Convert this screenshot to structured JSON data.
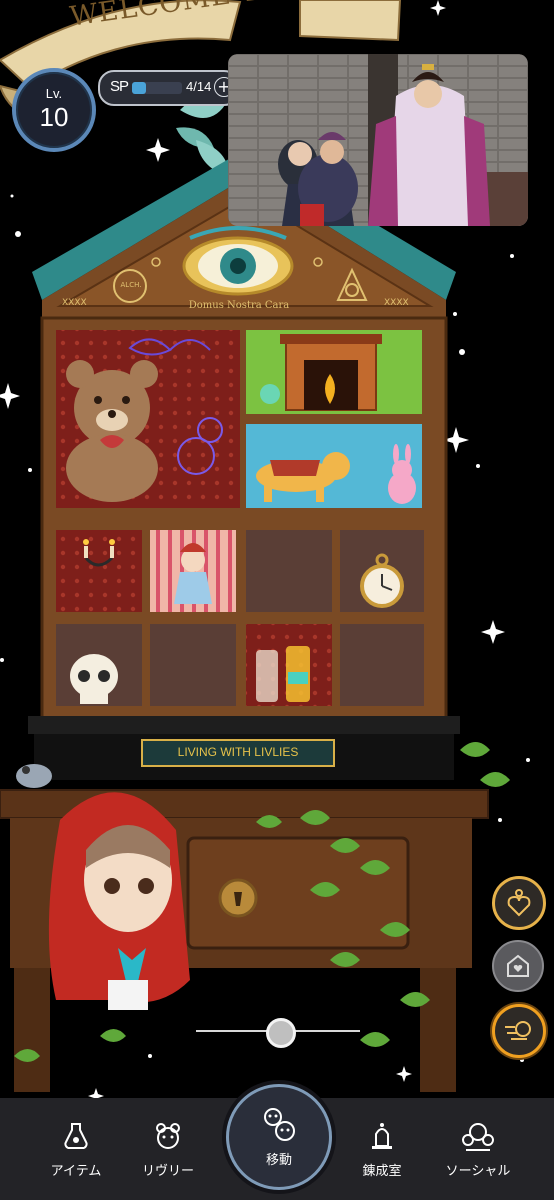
{
  "banner": {
    "text": "WELCOME TO OUR HOUSE"
  },
  "hud": {
    "level_label": "Lv.",
    "level_value": "10",
    "sp_label": "SP",
    "sp_value": "4/14",
    "sp_fraction": 0.2857,
    "sp_plus": "+"
  },
  "house": {
    "sign_left": "XXXX",
    "sign_title": "Domus Nostra Cara",
    "sign_right": "XXXX",
    "alchemy_mark": "ALCH.",
    "plaque": "LIVING WITH LIVLIES"
  },
  "side_buttons": [
    {
      "icon": "heart-locket-icon"
    },
    {
      "icon": "house-heart-icon"
    },
    {
      "icon": "speed-lines-icon"
    }
  ],
  "nav": {
    "items": [
      {
        "label": "アイテム",
        "icon": "potion-flask-icon"
      },
      {
        "label": "リヴリー",
        "icon": "livly-bear-icon"
      },
      {
        "label": "移動",
        "icon": "move-creatures-icon"
      },
      {
        "label": "錬成室",
        "icon": "alchemy-bell-icon"
      },
      {
        "label": "ソーシャル",
        "icon": "social-group-icon"
      }
    ]
  },
  "colors": {
    "accent_orange": "#f0a020",
    "hud_blue": "#4aa3d8",
    "nav_bg": "#232327",
    "wood": "#7a4a24"
  }
}
